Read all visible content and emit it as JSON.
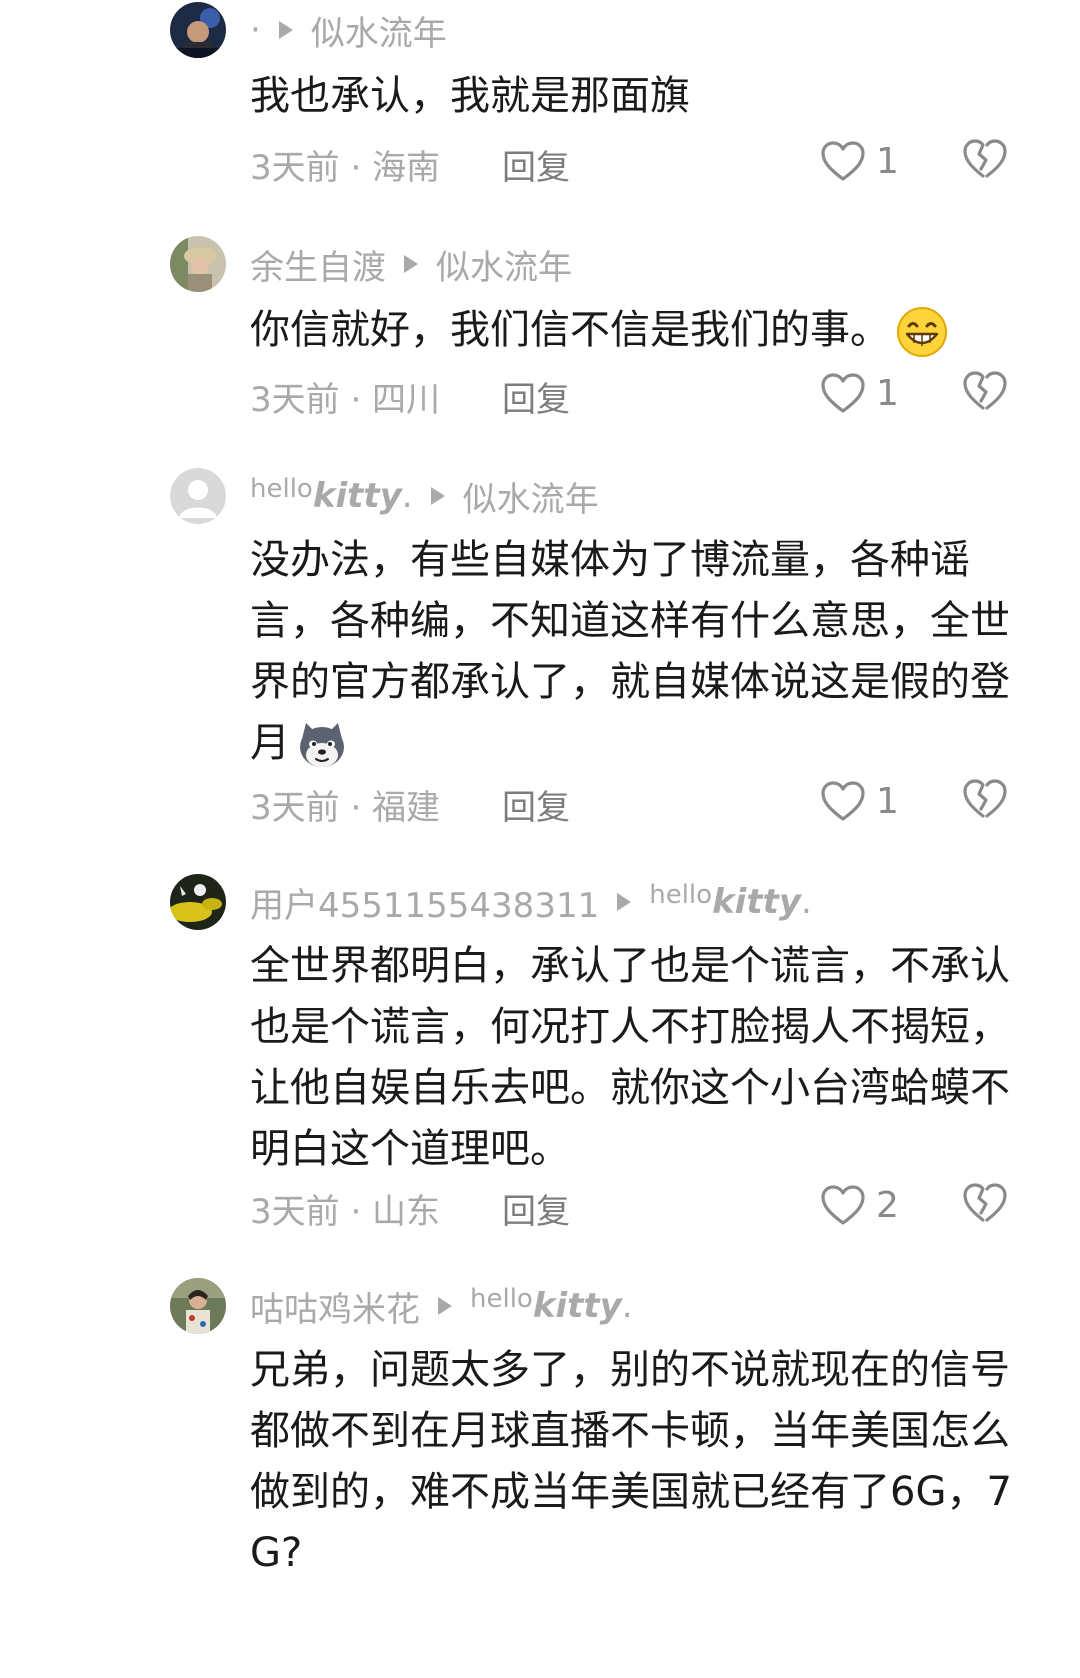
{
  "comments": [
    {
      "author": "·",
      "reply_to": "似水流年",
      "text": "我也承认，我就是那面旗",
      "time_location": "3天前 · 海南",
      "reply_label": "回复",
      "likes": "1"
    },
    {
      "author": "余生自渡",
      "reply_to": "似水流年",
      "text": "你信就好，我们信不信是我们的事。",
      "emoji": "grinning-face-icon",
      "time_location": "3天前 · 四川",
      "reply_label": "回复",
      "likes": "1"
    },
    {
      "author_small": "hello",
      "author_bold": "kitty",
      "author_dot": ".",
      "reply_to": "似水流年",
      "text": "没办法，有些自媒体为了博流量，各种谣言，各种编，不知道这样有什么意思，全世界的官方都承认了，就自媒体说这是假的登月",
      "emoji": "dog-face-icon",
      "time_location": "3天前 · 福建",
      "reply_label": "回复",
      "likes": "1"
    },
    {
      "author": "用户4551155438311",
      "reply_to_small": "hello",
      "reply_to_bold": "kitty",
      "reply_to_dot": ".",
      "text": "全世界都明白，承认了也是个谎言，不承认也是个谎言，何况打人不打脸揭人不揭短，让他自娱自乐去吧。就你这个小台湾蛤蟆不明白这个道理吧。",
      "time_location": "3天前 · 山东",
      "reply_label": "回复",
      "likes": "2"
    },
    {
      "author": "咕咕鸡米花",
      "reply_to_small": "hello",
      "reply_to_bold": "kitty",
      "reply_to_dot": ".",
      "text": "兄弟，问题太多了，别的不说就现在的信号都做不到在月球直播不卡顿，当年美国怎么做到的，难不成当年美国就已经有了6G，7G?"
    }
  ],
  "colors": {
    "text": "#1a1a1a",
    "meta": "#a9a9a9",
    "reply": "#7d7d7d",
    "icon": "#8a8a8a"
  }
}
